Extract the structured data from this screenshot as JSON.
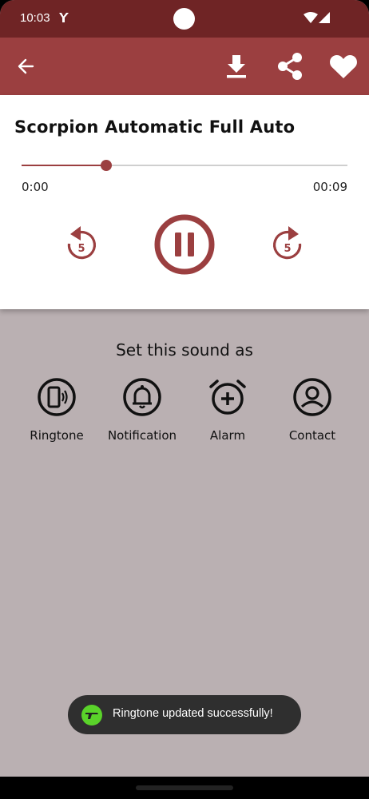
{
  "status_bar": {
    "time": "10:03",
    "icons": [
      "fork-icon",
      "wifi-icon",
      "signal-icon"
    ]
  },
  "toolbar": {
    "icons": [
      "back-arrow-icon",
      "download-icon",
      "share-icon",
      "heart-icon"
    ],
    "background_color": "#9b3f40"
  },
  "player": {
    "title": "Scorpion Automatic Full Auto",
    "current_time": "0:00",
    "duration": "00:09",
    "progress_fraction": 0.26,
    "rewind_seconds": "5",
    "forward_seconds": "5",
    "accent_color": "#9b3f40"
  },
  "set_as": {
    "title": "Set this sound as",
    "options": [
      {
        "label": "Ringtone",
        "icon": "phone-ringing-icon"
      },
      {
        "label": "Notification",
        "icon": "bell-icon"
      },
      {
        "label": "Alarm",
        "icon": "alarm-clock-icon"
      },
      {
        "label": "Contact",
        "icon": "contact-person-icon"
      }
    ]
  },
  "toast": {
    "message": "Ringtone updated successfully!",
    "icon": "app-gun-icon",
    "icon_color": "#5ad32a"
  }
}
